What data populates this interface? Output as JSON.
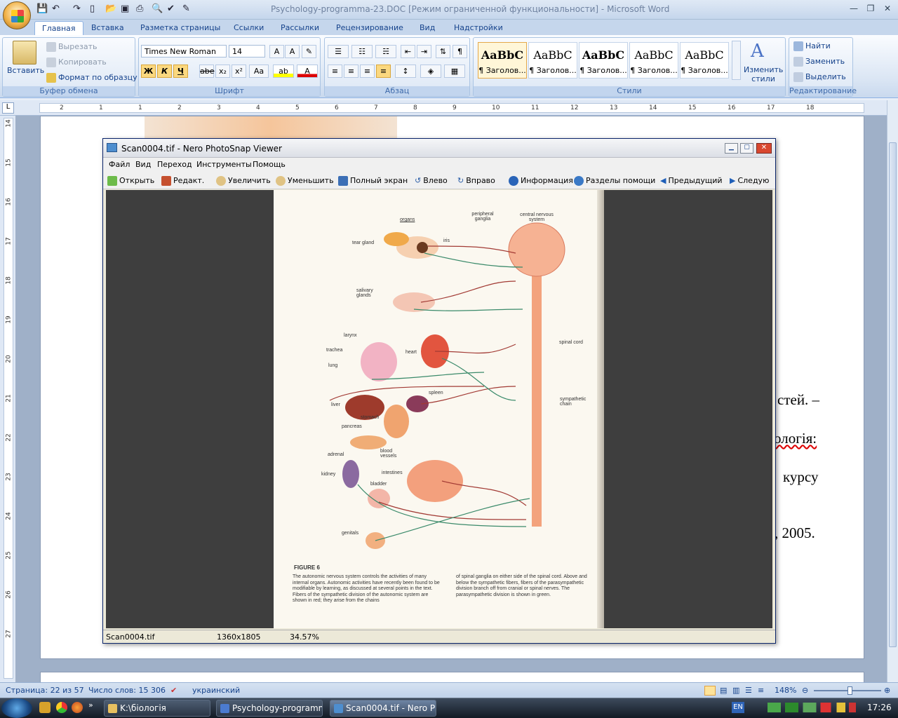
{
  "word": {
    "title": "Psychology-programma-23.DOC [Режим ограниченной функциональности] - Microsoft Word",
    "tabs": [
      "Главная",
      "Вставка",
      "Разметка страницы",
      "Ссылки",
      "Рассылки",
      "Рецензирование",
      "Вид",
      "Надстройки"
    ],
    "clipboard": {
      "paste": "Вставить",
      "cut": "Вырезать",
      "copy": "Копировать",
      "format_painter": "Формат по образцу",
      "caption": "Буфер обмена"
    },
    "font": {
      "name": "Times New Roman",
      "size": "14",
      "caption": "Шрифт",
      "bold": "Ж",
      "italic": "К",
      "underline": "Ч",
      "strike": "abe",
      "sub": "x₂",
      "sup": "x²",
      "case": "Aa"
    },
    "paragraph": {
      "caption": "Абзац"
    },
    "styles": {
      "caption": "Стили",
      "sample": "AaBbC",
      "sample2": "AaBbC",
      "items": [
        "¶ Заголов...",
        "¶ Заголов...",
        "¶ Заголов...",
        "¶ Заголов...",
        "¶ Заголов..."
      ],
      "change": "Изменить стили"
    },
    "editing": {
      "find": "Найти",
      "replace": "Заменить",
      "select": "Выделить",
      "caption": "Редактирование"
    },
    "ruler_numbers": [
      "2",
      "1",
      "1",
      "2",
      "3",
      "4",
      "5",
      "6",
      "7",
      "8",
      "9",
      "10",
      "11",
      "12",
      "13",
      "14",
      "15",
      "16",
      "17",
      "18"
    ],
    "vruler_numbers": [
      "14",
      "15",
      "16",
      "17",
      "18",
      "19",
      "20",
      "21",
      "22",
      "23",
      "24",
      "25",
      "26",
      "27"
    ],
    "doc_lines": [
      "стей. –",
      "ологія:",
      "курсу",
      ", 2005."
    ],
    "status": {
      "page": "Страница: 22 из 57",
      "words": "Число слов: 15 306",
      "lang": "украинский",
      "zoom": "148%"
    }
  },
  "viewer": {
    "title": "Scan0004.tif - Nero PhotoSnap Viewer",
    "menu": [
      "Файл",
      "Вид",
      "Переход",
      "Инструменты",
      "Помощь"
    ],
    "toolbar": [
      "Открыть",
      "Редакт.",
      "Увеличить",
      "Уменьшить",
      "Полный экран",
      "Влево",
      "Вправо",
      "Информация",
      "Разделы помощи",
      "Предыдущий",
      "Следую"
    ],
    "status": {
      "file": "Scan0004.tif",
      "dims": "1360x1805",
      "zoom": "34.57%"
    }
  },
  "scan": {
    "headers": [
      "organs",
      "peripheral ganglia",
      "central nervous system"
    ],
    "labels": [
      "tear gland",
      "iris",
      "salivary glands",
      "larynx",
      "trachea",
      "lung",
      "heart",
      "spinal cord",
      "liver",
      "spleen",
      "stomach",
      "pancreas",
      "sympathetic chain",
      "blood vessels",
      "adrenal",
      "kidney",
      "intestines",
      "bladder",
      "genitals"
    ],
    "fig_title": "FIGURE 6",
    "caption_left": "The autonomic nervous system controls the activities of many internal organs. Autonomic activities have recently been found to be modifiable by learning, as discussed at several points in the text. Fibers of the sympathetic division of the autonomic system are shown in red; they arise from the chains",
    "caption_right": "of spinal ganglia on either side of the spinal cord. Above and below the sympathetic fibers, fibers of the parasympathetic division branch off from cranial or spinal nerves. The parasympathetic division is shown in green."
  },
  "taskbar": {
    "items": [
      "K:\\біологія",
      "Psychology-programm...",
      "Scan0004.tif - Nero Ph..."
    ],
    "lang": "EN",
    "clock": "17:26"
  }
}
